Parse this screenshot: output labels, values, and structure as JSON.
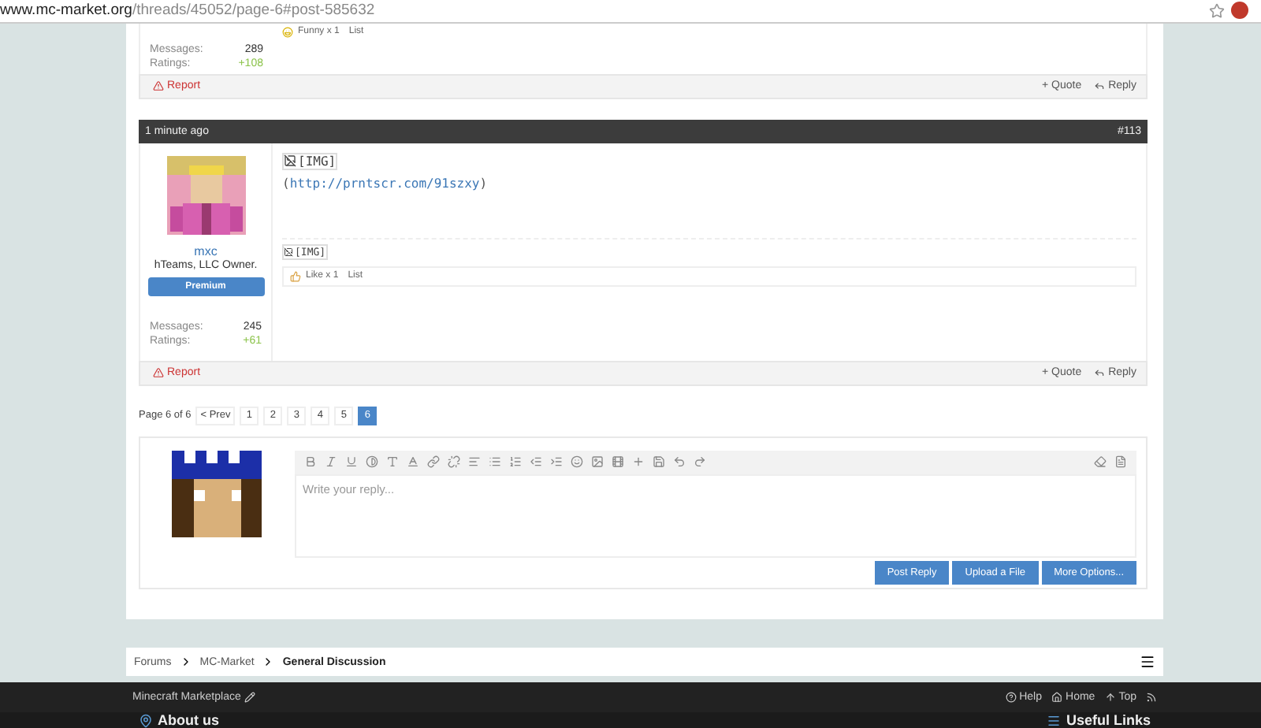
{
  "browser": {
    "url_host": "www.mc-market.org",
    "url_path": "/threads/45052/page-6#post-585632"
  },
  "previous_post": {
    "reaction": {
      "label": "Funny x 1",
      "list": "List"
    },
    "stats": [
      {
        "label": "Messages:",
        "value": "289"
      },
      {
        "label": "Ratings:",
        "value": "+108"
      }
    ],
    "report": "Report",
    "actions": [
      "+ Quote",
      "Reply"
    ]
  },
  "post": {
    "time": "1 minute ago",
    "number": "#113",
    "user": {
      "name": "mxc",
      "title": "hTeams, LLC Owner.",
      "badge": "Premium",
      "stats": [
        {
          "label": "Messages:",
          "value": "245"
        },
        {
          "label": "Ratings:",
          "value": "+61"
        }
      ]
    },
    "image_alt": "[IMG]",
    "link_before": "(",
    "link": "http://prntscr.com/91szxy",
    "link_after": ")",
    "signature_image_alt": "[IMG]",
    "reaction": {
      "label": "Like x 1",
      "list": "List"
    },
    "report": "Report",
    "actions": [
      "+ Quote",
      "Reply"
    ]
  },
  "pagination": {
    "label": "Page 6 of 6",
    "prev": "< Prev",
    "pages": [
      {
        "label": "1",
        "selected": false
      },
      {
        "label": "2",
        "selected": false
      },
      {
        "label": "3",
        "selected": false
      },
      {
        "label": "4",
        "selected": false
      },
      {
        "label": "5",
        "selected": false
      },
      {
        "label": "6",
        "selected": true
      }
    ]
  },
  "reply": {
    "placeholder": "Write your reply...",
    "buttons": [
      "Post Reply",
      "Upload a File",
      "More Options..."
    ]
  },
  "breadcrumb": [
    {
      "label": "Forums",
      "current": false
    },
    {
      "label": "MC-Market",
      "current": false
    },
    {
      "label": "General Discussion",
      "current": true
    }
  ],
  "footer": {
    "site": "Minecraft Marketplace",
    "links": [
      "Help",
      "Home",
      "Top"
    ],
    "sections": [
      "About us",
      "Useful Links"
    ]
  }
}
